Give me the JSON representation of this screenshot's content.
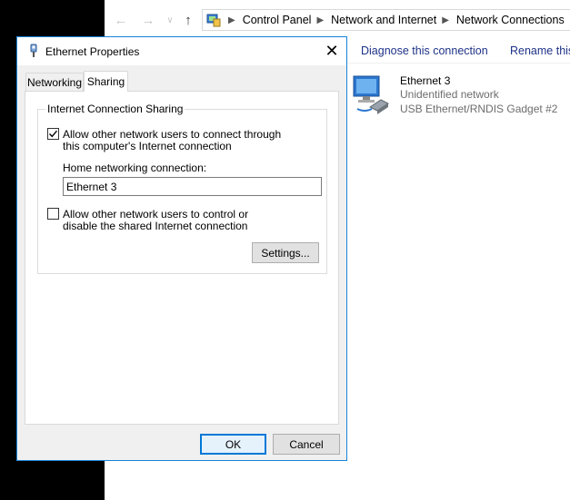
{
  "explorer": {
    "breadcrumb": [
      "Control Panel",
      "Network and Internet",
      "Network Connections"
    ],
    "commands": {
      "diagnose": "Diagnose this connection",
      "rename": "Rename this"
    },
    "connection": {
      "name": "Ethernet 3",
      "status": "Unidentified network",
      "device": "USB Ethernet/RNDIS Gadget #2"
    }
  },
  "dialog": {
    "title": "Ethernet Properties",
    "tabs": [
      {
        "label": "Networking",
        "active": false
      },
      {
        "label": "Sharing",
        "active": true
      }
    ],
    "ics": {
      "group_label": "Internet Connection Sharing",
      "allow_connect": {
        "label": "Allow other network users to connect through this computer's Internet connection",
        "checked": true
      },
      "home_label": "Home networking connection:",
      "home_value": "Ethernet 3",
      "allow_control": {
        "label": "Allow other network users to control or disable the shared Internet connection",
        "checked": false
      },
      "settings_button": "Settings..."
    },
    "buttons": {
      "ok": "OK",
      "cancel": "Cancel"
    }
  },
  "colors": {
    "link_blue": "#1e3287",
    "accent_blue": "#0078d7",
    "dialog_bg": "#f0f0f0",
    "desktop": "#000000"
  }
}
